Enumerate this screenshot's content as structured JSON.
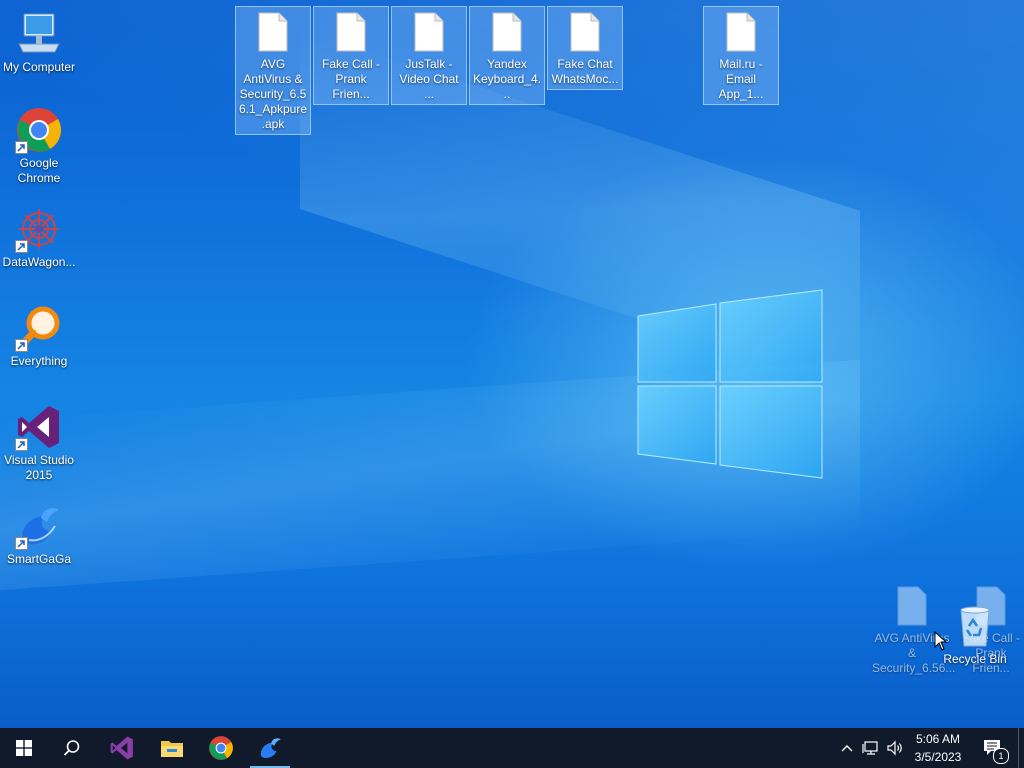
{
  "desktop_icons": [
    {
      "label": "My Computer"
    },
    {
      "label": "Google Chrome"
    },
    {
      "label": "DataWagon..."
    },
    {
      "label": "Everything"
    },
    {
      "label": "Visual Studio 2015"
    },
    {
      "label": "SmartGaGa"
    }
  ],
  "selected_files": [
    {
      "label": "AVG AntiVirus & Security_6.56.1_Apkpure.apk"
    },
    {
      "label": "Fake Call - Prank Frien..."
    },
    {
      "label": "JusTalk - Video Chat ..."
    },
    {
      "label": "Yandex Keyboard_4..."
    },
    {
      "label": "Fake Chat WhatsMoc..."
    },
    {
      "label": "Mail.ru - Email App_1..."
    }
  ],
  "dragging": {
    "labels": [
      "AVG AntiVirus & Security_6.56...",
      "Fake Call - Prank Frien..."
    ]
  },
  "recycle_bin": {
    "label": "Recycle Bin"
  },
  "taskbar": {
    "start_icon": "windows-start-icon",
    "search_icon": "search-icon",
    "pinned": [
      "visual-studio-icon",
      "file-explorer-icon",
      "chrome-icon",
      "smartgaga-icon"
    ],
    "active_app": "smartgaga-icon"
  },
  "tray": {
    "time": "5:06 AM",
    "date": "3/5/2023",
    "notification_count": "1"
  },
  "colors": {
    "desktop_blue": "#1072dc",
    "taskbar": "#101a2b",
    "selection": "#99ccff"
  }
}
